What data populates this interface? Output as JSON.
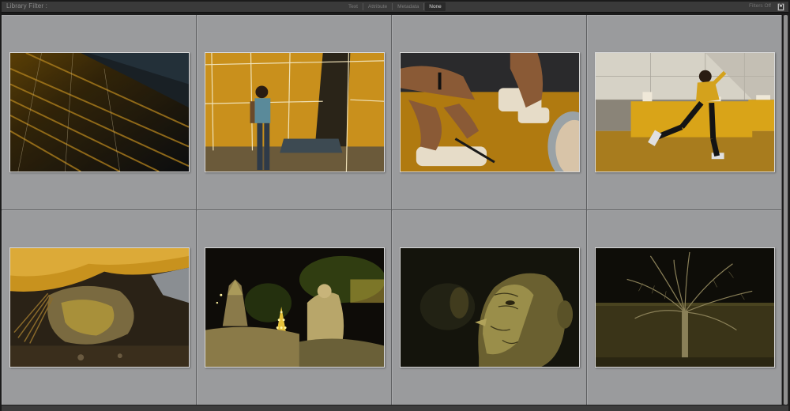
{
  "filter_bar": {
    "title": "Library Filter :",
    "tabs": [
      {
        "label": "Text",
        "active": false
      },
      {
        "label": "Attribute",
        "active": false
      },
      {
        "label": "Metadata",
        "active": false
      },
      {
        "label": "None",
        "active": true
      }
    ],
    "filters_status": "Filters Off",
    "lock_icon": "lock-icon"
  },
  "grid": {
    "columns": 4,
    "rows": 2,
    "cell_bg": "#9a9b9d",
    "thumbnails": [
      {
        "subject": "dark pavement with golden light streaks"
      },
      {
        "subject": "man walking in front of yellow tent"
      },
      {
        "subject": "hands cutting food on yellow cloth"
      },
      {
        "subject": "boy running past tables"
      },
      {
        "subject": "broom under yellow tarp"
      },
      {
        "subject": "illuminated temple and statues at night"
      },
      {
        "subject": "close-up of elderly man's face"
      },
      {
        "subject": "bare palm tree against night wall"
      }
    ]
  },
  "colors": {
    "accent_gold": "#c9961c",
    "toolbar": "#3a3a3a",
    "grid_bg": "#9a9b9d"
  }
}
